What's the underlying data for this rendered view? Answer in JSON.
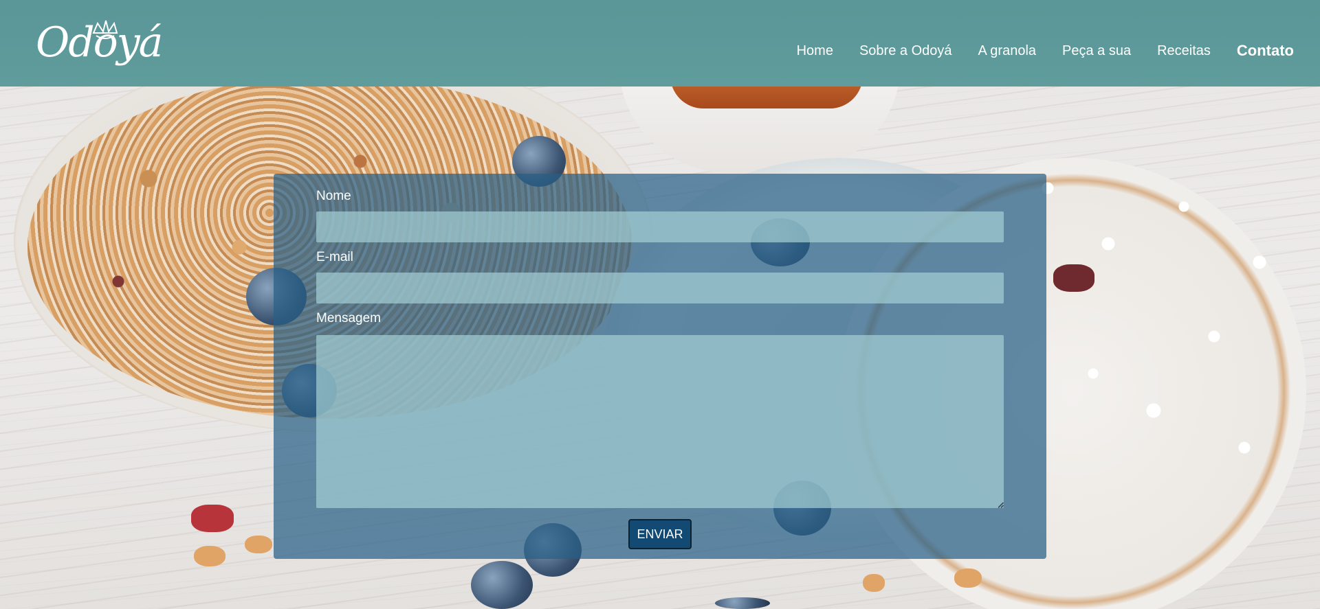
{
  "brand": {
    "logo_text": "Odoyá"
  },
  "nav": {
    "items": [
      {
        "label": "Home"
      },
      {
        "label": "Sobre a Odoyá"
      },
      {
        "label": "A granola"
      },
      {
        "label": "Peça a sua"
      },
      {
        "label": "Receitas"
      },
      {
        "label": "Contato",
        "active": true
      }
    ]
  },
  "contact_form": {
    "name_label": "Nome",
    "name_value": "",
    "email_label": "E-mail",
    "email_value": "",
    "message_label": "Mensagem",
    "message_value": "",
    "submit_label": "ENVIAR"
  },
  "colors": {
    "header_bg": "#5b9698",
    "panel_bg": "#285f87",
    "field_bg": "#a2cdd2",
    "button_bg": "#124a73",
    "text": "#ffffff"
  }
}
